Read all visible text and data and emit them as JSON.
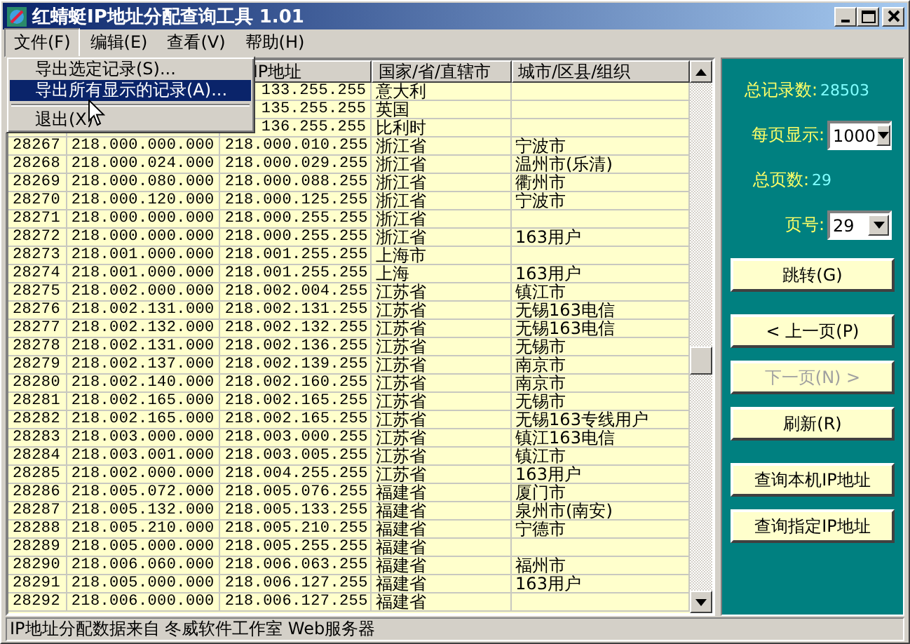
{
  "window": {
    "title": "红蜻蜓IP地址分配查询工具 1.01"
  },
  "menu_bar": [
    {
      "label": "文件(F)",
      "selected": true
    },
    {
      "label": "编辑(E)",
      "selected": false
    },
    {
      "label": "查看(V)",
      "selected": false
    },
    {
      "label": "帮助(H)",
      "selected": false
    }
  ],
  "open_menu": {
    "items": [
      {
        "kind": "item",
        "label": "导出选定记录(S)...",
        "selected": false
      },
      {
        "kind": "item",
        "label": "导出所有显示的记录(A)...",
        "selected": true
      },
      {
        "kind": "separator"
      },
      {
        "kind": "item",
        "label": "退出(X)",
        "selected": false
      }
    ]
  },
  "table": {
    "columns": [
      {},
      {},
      {
        "label": "IP地址",
        "clipped": true
      },
      {
        "label": "国家/省/直辖市"
      },
      {
        "label": "城市/区县/组织"
      }
    ],
    "rows": [
      {
        "cells": [
          null,
          null,
          "133.255.255",
          "意大利",
          null
        ],
        "clipped": true
      },
      {
        "cells": [
          null,
          null,
          "135.255.255",
          "英国",
          null
        ],
        "clipped": true
      },
      {
        "cells": [
          null,
          null,
          "136.255.255",
          "比利时",
          null
        ],
        "clipped": true
      },
      {
        "cells": [
          "28267",
          "218.000.000.000",
          "218.000.010.255",
          "浙江省",
          "宁波市"
        ]
      },
      {
        "cells": [
          "28268",
          "218.000.024.000",
          "218.000.029.255",
          "浙江省",
          "温州市(乐清)"
        ]
      },
      {
        "cells": [
          "28269",
          "218.000.080.000",
          "218.000.088.255",
          "浙江省",
          "衢州市"
        ]
      },
      {
        "cells": [
          "28270",
          "218.000.120.000",
          "218.000.125.255",
          "浙江省",
          "宁波市"
        ]
      },
      {
        "cells": [
          "28271",
          "218.000.000.000",
          "218.000.255.255",
          "浙江省",
          null
        ]
      },
      {
        "cells": [
          "28272",
          "218.000.000.000",
          "218.000.255.255",
          "浙江省",
          "163用户"
        ]
      },
      {
        "cells": [
          "28273",
          "218.001.000.000",
          "218.001.255.255",
          "上海市",
          null
        ]
      },
      {
        "cells": [
          "28274",
          "218.001.000.000",
          "218.001.255.255",
          "上海",
          "163用户"
        ]
      },
      {
        "cells": [
          "28275",
          "218.002.000.000",
          "218.002.004.255",
          "江苏省",
          "镇江市"
        ]
      },
      {
        "cells": [
          "28276",
          "218.002.131.000",
          "218.002.131.255",
          "江苏省",
          "无锡163电信"
        ]
      },
      {
        "cells": [
          "28277",
          "218.002.132.000",
          "218.002.132.255",
          "江苏省",
          "无锡163电信"
        ]
      },
      {
        "cells": [
          "28278",
          "218.002.131.000",
          "218.002.136.255",
          "江苏省",
          "无锡市"
        ]
      },
      {
        "cells": [
          "28279",
          "218.002.137.000",
          "218.002.139.255",
          "江苏省",
          "南京市"
        ]
      },
      {
        "cells": [
          "28280",
          "218.002.140.000",
          "218.002.160.255",
          "江苏省",
          "南京市"
        ]
      },
      {
        "cells": [
          "28281",
          "218.002.165.000",
          "218.002.165.255",
          "江苏省",
          "无锡市"
        ]
      },
      {
        "cells": [
          "28282",
          "218.002.165.000",
          "218.002.165.255",
          "江苏省",
          "无锡163专线用户"
        ]
      },
      {
        "cells": [
          "28283",
          "218.003.000.000",
          "218.003.000.255",
          "江苏省",
          "镇江163电信"
        ]
      },
      {
        "cells": [
          "28284",
          "218.003.001.000",
          "218.003.005.255",
          "江苏省",
          "镇江市"
        ]
      },
      {
        "cells": [
          "28285",
          "218.002.000.000",
          "218.004.255.255",
          "江苏省",
          "163用户"
        ]
      },
      {
        "cells": [
          "28286",
          "218.005.072.000",
          "218.005.076.255",
          "福建省",
          "厦门市"
        ]
      },
      {
        "cells": [
          "28287",
          "218.005.132.000",
          "218.005.133.255",
          "福建省",
          "泉州市(南安)"
        ]
      },
      {
        "cells": [
          "28288",
          "218.005.210.000",
          "218.005.210.255",
          "福建省",
          "宁德市"
        ]
      },
      {
        "cells": [
          "28289",
          "218.005.000.000",
          "218.005.255.255",
          "福建省",
          null
        ]
      },
      {
        "cells": [
          "28290",
          "218.006.060.000",
          "218.006.063.255",
          "福建省",
          "福州市"
        ]
      },
      {
        "cells": [
          "28291",
          "218.005.000.000",
          "218.006.127.255",
          "福建省",
          "163用户"
        ]
      },
      {
        "cells": [
          "28292",
          "218.006.000.000",
          "218.006.127.255",
          "福建省",
          null
        ]
      }
    ]
  },
  "side_panel": {
    "fields": [
      {
        "kind": "value",
        "label": "总记录数:",
        "value": "28503"
      },
      {
        "kind": "select",
        "label": "每页显示:",
        "value": "1000"
      },
      {
        "kind": "value",
        "label": "总页数:",
        "value": "29"
      },
      {
        "kind": "select",
        "label": "页号:",
        "value": "29"
      }
    ],
    "buttons": [
      {
        "label": "跳转(G)",
        "disabled": false
      },
      {
        "label": "< 上一页(P)",
        "disabled": false
      },
      {
        "label": "下一页(N) >",
        "disabled": true
      },
      {
        "label": "刷新(R)",
        "disabled": false
      },
      {
        "label": "查询本机IP地址",
        "disabled": false
      },
      {
        "label": "查询指定IP地址",
        "disabled": false
      }
    ]
  },
  "status_bar": "IP地址分配数据来自 冬威软件工作室 Web服务器"
}
